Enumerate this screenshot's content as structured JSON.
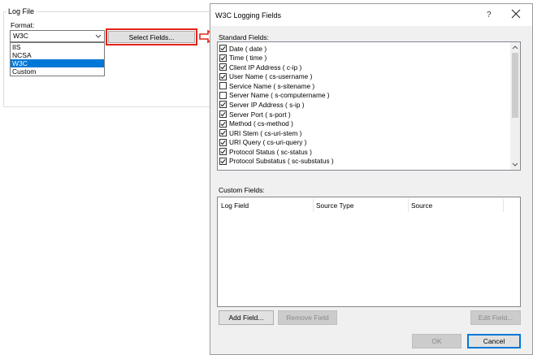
{
  "log_file": {
    "group_title": "Log File",
    "format_label": "Format:",
    "format_value": "W3C",
    "format_options": [
      "IIS",
      "NCSA",
      "W3C",
      "Custom"
    ],
    "select_fields_label": "Select Fields..."
  },
  "dialog": {
    "title": "W3C Logging Fields",
    "help_label": "?",
    "standard_fields_label": "Standard Fields:",
    "standard_fields": [
      {
        "label": "Date ( date )",
        "checked": true
      },
      {
        "label": "Time ( time )",
        "checked": true
      },
      {
        "label": "Client IP Address ( c-ip )",
        "checked": true
      },
      {
        "label": "User Name ( cs-username )",
        "checked": true
      },
      {
        "label": "Service Name ( s-sitename )",
        "checked": false
      },
      {
        "label": "Server Name ( s-computername )",
        "checked": false
      },
      {
        "label": "Server IP Address ( s-ip )",
        "checked": true
      },
      {
        "label": "Server Port ( s-port )",
        "checked": true
      },
      {
        "label": "Method ( cs-method )",
        "checked": true
      },
      {
        "label": "URI Stem ( cs-uri-stem )",
        "checked": true
      },
      {
        "label": "URI Query ( cs-uri-query )",
        "checked": true
      },
      {
        "label": "Protocol Status ( sc-status )",
        "checked": true
      },
      {
        "label": "Protocol Substatus ( sc-substatus )",
        "checked": true
      }
    ],
    "custom_fields_label": "Custom Fields:",
    "custom_columns": [
      "Log Field",
      "Source Type",
      "Source"
    ],
    "add_field_label": "Add Field...",
    "remove_field_label": "Remove Field",
    "edit_field_label": "Edit Field...",
    "ok_label": "OK",
    "cancel_label": "Cancel"
  },
  "colors": {
    "highlight": "#e2231a",
    "selection": "#0078d7"
  }
}
